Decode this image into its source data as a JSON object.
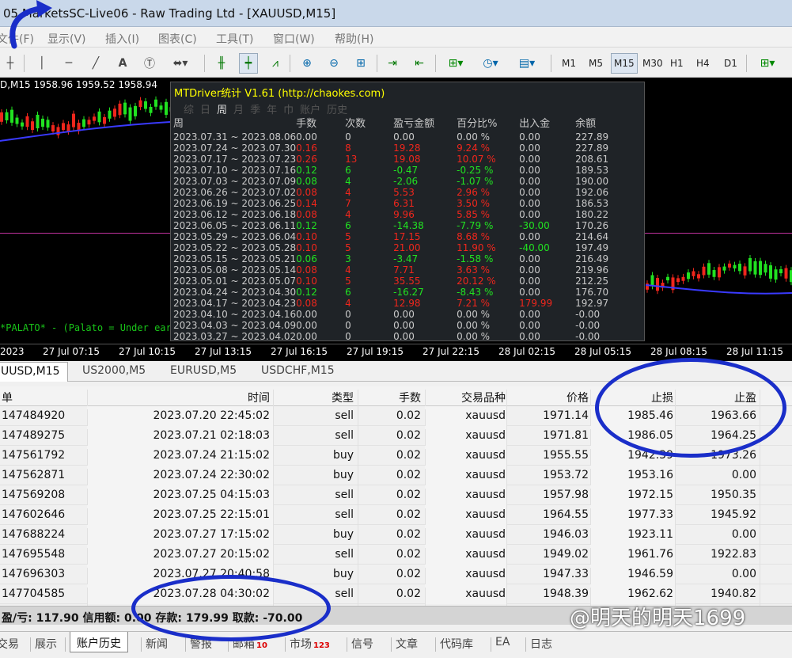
{
  "window": {
    "title": "05  MarketsSC-Live06 - Raw Trading Ltd - [XAUUSD,M15]"
  },
  "menu": [
    "文件(F)",
    "显示(V)",
    "插入(I)",
    "图表(C)",
    "工具(T)",
    "窗口(W)",
    "帮助(H)"
  ],
  "toolbar": {
    "timeframes": [
      "M1",
      "M5",
      "M15",
      "M30",
      "H1",
      "H4",
      "D1"
    ],
    "selected": "M15"
  },
  "chart": {
    "info": "D,M15  1958.96 1959.52 1958.94",
    "indicator_text": "*PALATO* - (Palato = Under eart",
    "xaxis": [
      "2023",
      "27 Jul 07:15",
      "27 Jul 10:15",
      "27 Jul 13:15",
      "27 Jul 16:15",
      "27 Jul 19:15",
      "27 Jul 22:15",
      "28 Jul 02:15",
      "28 Jul 05:15",
      "28 Jul 08:15",
      "28 Jul 11:15"
    ],
    "colors": {
      "bull": "#21e221",
      "bear": "#f0261c",
      "ma": "#3a3aff",
      "level": "#c0329f"
    }
  },
  "stats": {
    "title": "MTDriver统计 V1.61  (http://chaokes.com)",
    "tabs": [
      "综",
      "日",
      "周",
      "月",
      "季",
      "年",
      "巾",
      "账户",
      "历史"
    ],
    "active_tab": "周",
    "headers": [
      "周",
      "手数",
      "次数",
      "盈亏金额",
      "百分比%",
      "出入金",
      "余额"
    ],
    "rows": [
      [
        "2023.07.31 ~ 2023.08.06",
        "0.00",
        "0",
        "0.00",
        "0.00 %",
        "0.00",
        "227.89"
      ],
      [
        "2023.07.24 ~ 2023.07.30",
        "0.16",
        "8",
        "19.28",
        "9.24 %",
        "0.00",
        "227.89"
      ],
      [
        "2023.07.17 ~ 2023.07.23",
        "0.26",
        "13",
        "19.08",
        "10.07 %",
        "0.00",
        "208.61"
      ],
      [
        "2023.07.10 ~ 2023.07.16",
        "0.12",
        "6",
        "-0.47",
        "-0.25 %",
        "0.00",
        "189.53"
      ],
      [
        "2023.07.03 ~ 2023.07.09",
        "0.08",
        "4",
        "-2.06",
        "-1.07 %",
        "0.00",
        "190.00"
      ],
      [
        "2023.06.26 ~ 2023.07.02",
        "0.08",
        "4",
        "5.53",
        "2.96 %",
        "0.00",
        "192.06"
      ],
      [
        "2023.06.19 ~ 2023.06.25",
        "0.14",
        "7",
        "6.31",
        "3.50 %",
        "0.00",
        "186.53"
      ],
      [
        "2023.06.12 ~ 2023.06.18",
        "0.08",
        "4",
        "9.96",
        "5.85 %",
        "0.00",
        "180.22"
      ],
      [
        "2023.06.05 ~ 2023.06.11",
        "0.12",
        "6",
        "-14.38",
        "-7.79 %",
        "-30.00",
        "170.26"
      ],
      [
        "2023.05.29 ~ 2023.06.04",
        "0.10",
        "5",
        "17.15",
        "8.68 %",
        "0.00",
        "214.64"
      ],
      [
        "2023.05.22 ~ 2023.05.28",
        "0.10",
        "5",
        "21.00",
        "11.90 %",
        "-40.00",
        "197.49"
      ],
      [
        "2023.05.15 ~ 2023.05.21",
        "0.06",
        "3",
        "-3.47",
        "-1.58 %",
        "0.00",
        "216.49"
      ],
      [
        "2023.05.08 ~ 2023.05.14",
        "0.08",
        "4",
        "7.71",
        "3.63 %",
        "0.00",
        "219.96"
      ],
      [
        "2023.05.01 ~ 2023.05.07",
        "0.10",
        "5",
        "35.55",
        "20.12 %",
        "0.00",
        "212.25"
      ],
      [
        "2023.04.24 ~ 2023.04.30",
        "0.12",
        "6",
        "-16.27",
        "-8.43 %",
        "0.00",
        "176.70"
      ],
      [
        "2023.04.17 ~ 2023.04.23",
        "0.08",
        "4",
        "12.98",
        "7.21 %",
        "179.99",
        "192.97"
      ],
      [
        "2023.04.10 ~ 2023.04.16",
        "0.00",
        "0",
        "0.00",
        "0.00 %",
        "0.00",
        "-0.00"
      ],
      [
        "2023.04.03 ~ 2023.04.09",
        "0.00",
        "0",
        "0.00",
        "0.00 %",
        "0.00",
        "-0.00"
      ],
      [
        "2023.03.27 ~ 2023.04.02",
        "0.00",
        "0",
        "0.00",
        "0.00 %",
        "0.00",
        "-0.00"
      ]
    ],
    "row_colors": [
      "n",
      "r",
      "r",
      "g",
      "g",
      "r",
      "r",
      "r",
      "g",
      "r",
      "r",
      "g",
      "r",
      "r",
      "g",
      "r",
      "n",
      "n",
      "n"
    ]
  },
  "symbol_tabs": [
    "UUSD,M15",
    "US2000,M5",
    "EURUSD,M5",
    "USDCHF,M15"
  ],
  "orders": {
    "headers": [
      "单",
      "时间",
      "类型",
      "手数",
      "交易品种",
      "价格",
      "止损",
      "止盈"
    ],
    "rows": [
      [
        "147484920",
        "2023.07.20 22:45:02",
        "sell",
        "0.02",
        "xauusd",
        "1971.14",
        "1985.46",
        "1963.66"
      ],
      [
        "147489275",
        "2023.07.21 02:18:03",
        "sell",
        "0.02",
        "xauusd",
        "1971.81",
        "1986.05",
        "1964.25"
      ],
      [
        "147561792",
        "2023.07.24 21:15:02",
        "buy",
        "0.02",
        "xauusd",
        "1955.55",
        "1942.39",
        "1973.26"
      ],
      [
        "147562871",
        "2023.07.24 22:30:02",
        "buy",
        "0.02",
        "xauusd",
        "1953.72",
        "1953.16",
        "0.00"
      ],
      [
        "147569208",
        "2023.07.25 04:15:03",
        "sell",
        "0.02",
        "xauusd",
        "1957.98",
        "1972.15",
        "1950.35"
      ],
      [
        "147602646",
        "2023.07.25 22:15:01",
        "sell",
        "0.02",
        "xauusd",
        "1964.55",
        "1977.33",
        "1945.92"
      ],
      [
        "147688224",
        "2023.07.27 17:15:02",
        "buy",
        "0.02",
        "xauusd",
        "1946.03",
        "1923.11",
        "0.00"
      ],
      [
        "147695548",
        "2023.07.27 20:15:02",
        "sell",
        "0.02",
        "xauusd",
        "1949.02",
        "1961.76",
        "1922.83"
      ],
      [
        "147696303",
        "2023.07.27 20:40:58",
        "buy",
        "0.02",
        "xauusd",
        "1947.33",
        "1946.59",
        "0.00"
      ],
      [
        "147704585",
        "2023.07.28 04:30:02",
        "sell",
        "0.02",
        "xauusd",
        "1948.39",
        "1962.62",
        "1940.82"
      ]
    ]
  },
  "summary": "盈/亏: 117.90  信用额: 0.00  存款: 179.99  取款: -70.00",
  "bottom_tabs": [
    {
      "label": "交易",
      "badge": ""
    },
    {
      "label": "展示",
      "badge": ""
    },
    {
      "label": "账户历史",
      "badge": ""
    },
    {
      "label": "新闻",
      "badge": ""
    },
    {
      "label": "警报",
      "badge": ""
    },
    {
      "label": "邮箱",
      "badge": "10"
    },
    {
      "label": "市场",
      "badge": "123"
    },
    {
      "label": "信号",
      "badge": ""
    },
    {
      "label": "文章",
      "badge": ""
    },
    {
      "label": "代码库",
      "badge": ""
    },
    {
      "label": "EA",
      "badge": ""
    },
    {
      "label": "日志",
      "badge": ""
    }
  ],
  "active_bottom_tab": "账户历史",
  "watermark": "@明天的明天1699"
}
